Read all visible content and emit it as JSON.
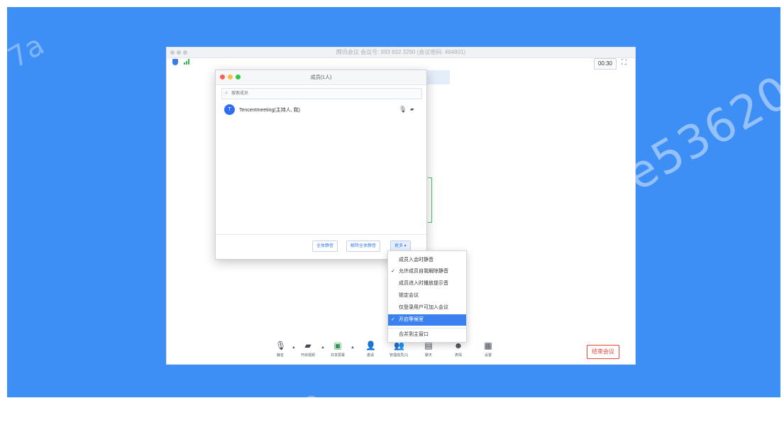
{
  "watermark": {
    "main": "e53620e77a",
    "left": "7a",
    "bottom": "2"
  },
  "meeting_window": {
    "title": "腾讯会议 会议号: 993 832 3290 (会议密码: 464801)",
    "timer": "00:30",
    "fullscreen_icon": "expand-icon"
  },
  "members_panel": {
    "title": "成员(1人)",
    "search_placeholder": "搜索成员",
    "members": [
      {
        "avatar_letter": "T",
        "name": "Tencentmeeting(主持人, 我)"
      }
    ],
    "buttons": {
      "mute_all": "全体静音",
      "unmute_all": "解除全体静音",
      "more": "更多 ▾"
    }
  },
  "more_menu": {
    "items": [
      {
        "label": "成员入会时静音",
        "checked": false,
        "selected": false
      },
      {
        "label": "允许成员自我解除静音",
        "checked": true,
        "selected": false
      },
      {
        "label": "成员进入时播放提示音",
        "checked": false,
        "selected": false
      },
      {
        "label": "锁定会议",
        "checked": false,
        "selected": false
      },
      {
        "label": "仅登录用户可加入会议",
        "checked": false,
        "selected": false
      },
      {
        "label": "开启等候室",
        "checked": true,
        "selected": true
      }
    ],
    "footer_item": "合并到主窗口"
  },
  "toolbar": {
    "items": [
      {
        "label": "静音",
        "icon": "mic-icon"
      },
      {
        "label": "开启视频",
        "icon": "camera-off-icon"
      },
      {
        "label": "共享屏幕",
        "icon": "screen-share-icon"
      },
      {
        "label": "邀请",
        "icon": "invite-icon"
      },
      {
        "label": "管理成员(1)",
        "icon": "members-icon"
      },
      {
        "label": "聊天",
        "icon": "chat-icon"
      },
      {
        "label": "表情",
        "icon": "emoji-icon"
      },
      {
        "label": "设置",
        "icon": "settings-icon"
      }
    ],
    "end_meeting": "结束会议"
  },
  "colors": {
    "background": "#3d8ef5",
    "accent": "#3a7bf0",
    "danger": "#e7443c",
    "success": "#3cba54"
  }
}
